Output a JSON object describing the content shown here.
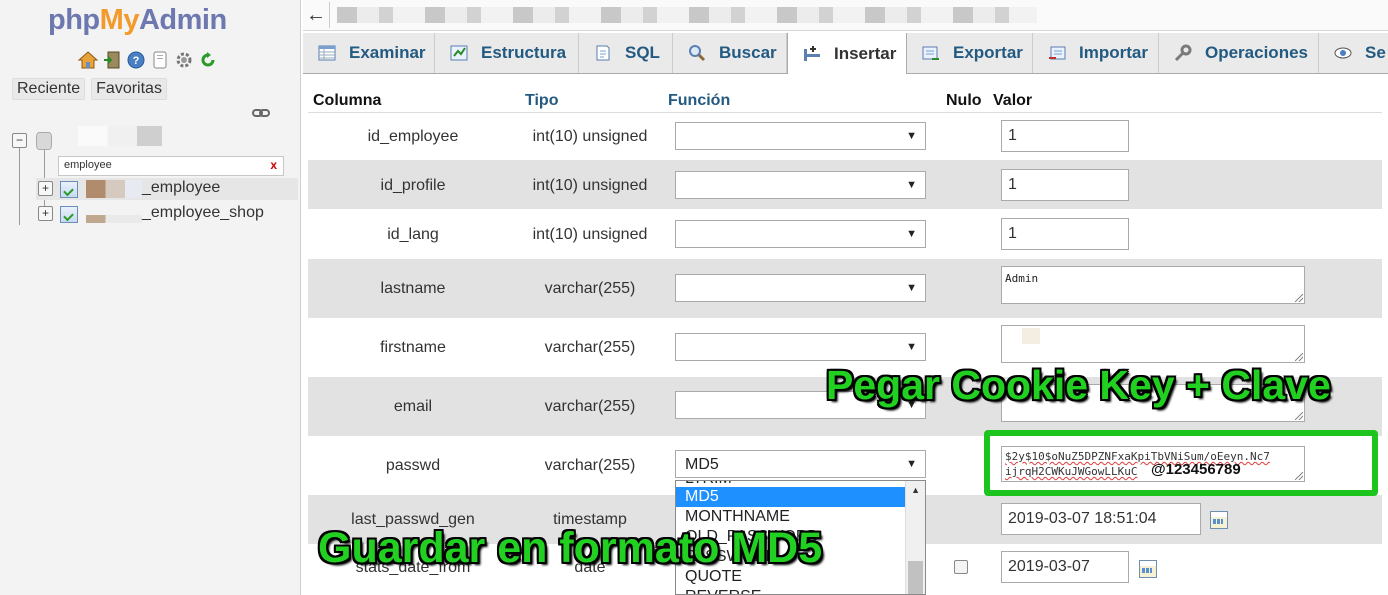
{
  "nav": {
    "logo_php": "php",
    "logo_my": "My",
    "logo_admin": "Admin",
    "icons": [
      "home-icon",
      "exit-icon",
      "help-icon",
      "docs-icon",
      "settings-icon",
      "reload-icon"
    ],
    "tab_recent": "Reciente",
    "tab_favorites": "Favoritas",
    "filter_value": "employee",
    "filter_clear": "x",
    "tree": [
      {
        "label": "_employee",
        "selected": true
      },
      {
        "label": "_employee_shop",
        "selected": false
      }
    ]
  },
  "topbar": {
    "back": "←"
  },
  "tabs": [
    {
      "label": "Examinar",
      "icon": "browse-icon"
    },
    {
      "label": "Estructura",
      "icon": "structure-icon"
    },
    {
      "label": "SQL",
      "icon": "sql-icon"
    },
    {
      "label": "Buscar",
      "icon": "search-icon"
    },
    {
      "label": "Insertar",
      "icon": "insert-icon",
      "active": true
    },
    {
      "label": "Exportar",
      "icon": "export-icon"
    },
    {
      "label": "Importar",
      "icon": "import-icon"
    },
    {
      "label": "Operaciones",
      "icon": "operations-icon"
    },
    {
      "label": "Se",
      "icon": "tracking-icon"
    }
  ],
  "table": {
    "headers": {
      "column": "Columna",
      "type": "Tipo",
      "function": "Función",
      "null": "Nulo",
      "value": "Valor"
    },
    "rows": [
      {
        "name": "id_employee",
        "type": "int(10) unsigned",
        "function": "",
        "value": "1"
      },
      {
        "name": "id_profile",
        "type": "int(10) unsigned",
        "function": "",
        "value": "1"
      },
      {
        "name": "id_lang",
        "type": "int(10) unsigned",
        "function": "",
        "value": "1"
      },
      {
        "name": "lastname",
        "type": "varchar(255)",
        "function": "",
        "value": "Admin"
      },
      {
        "name": "firstname",
        "type": "varchar(255)",
        "function": "",
        "value": ""
      },
      {
        "name": "email",
        "type": "varchar(255)",
        "function": "",
        "value": ""
      },
      {
        "name": "passwd",
        "type": "varchar(255)",
        "function": "MD5",
        "value_line1": "$2y$10$oNuZ5DPZNFxaKpiTbVNiSum/oEeyn.Nc7",
        "value_line2": "ijrqH2CWKuJWGowLLKuC",
        "value_suffix": "@123456789"
      },
      {
        "name": "last_passwd_gen",
        "type": "timestamp",
        "value": "2019-03-07 18:51:04"
      },
      {
        "name": "stats_date_from",
        "type": "date",
        "value": "2019-03-07"
      }
    ]
  },
  "dropdown": {
    "options": [
      "LTRIM",
      "MD5",
      "MONTHNAME",
      "OLD_PASSWORD",
      "PASSWORD",
      "QUOTE",
      "REVERSE"
    ],
    "selected": "MD5"
  },
  "captions": {
    "cookie": "Pegar Cookie Key + Clave",
    "md5": "Guardar en formato MD5"
  },
  "colors": {
    "caption_green": "#22d022",
    "highlight_box": "#1ec41e",
    "dropdown_selected": "#1e90ff",
    "tab_link": "#235a81"
  }
}
